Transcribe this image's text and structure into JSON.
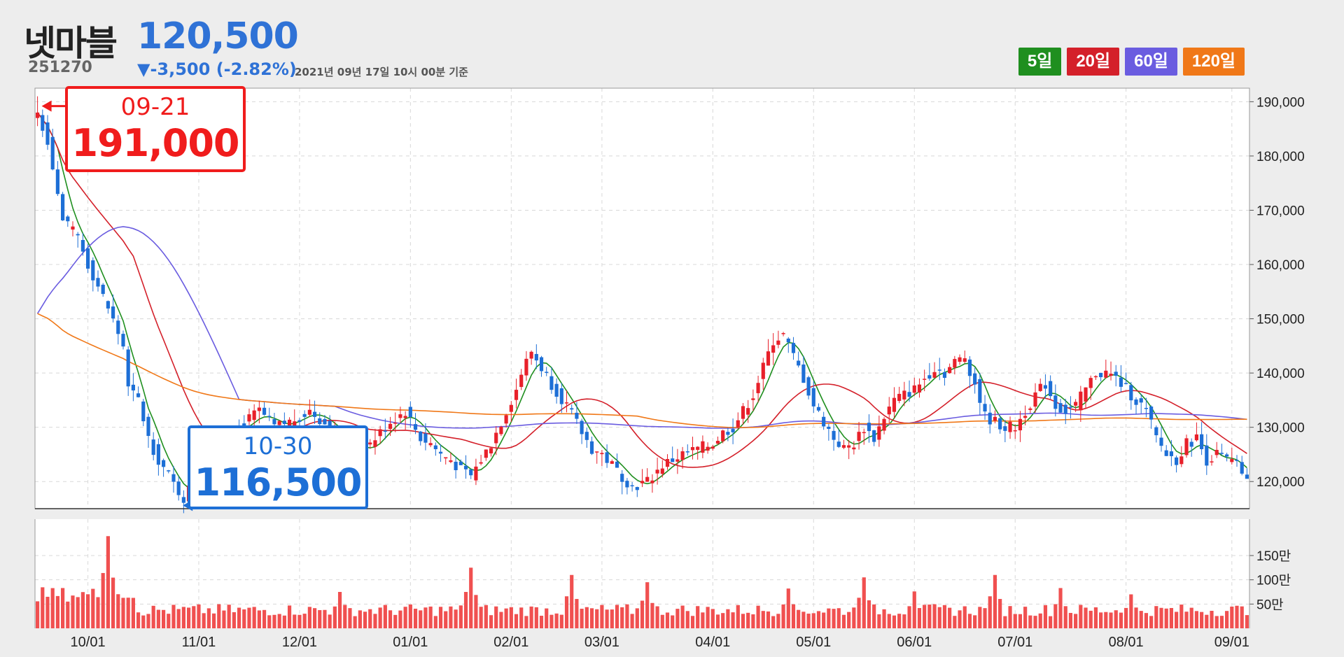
{
  "header": {
    "name": "넷마블",
    "code": "251270",
    "price": "120,500",
    "change": "▼-3,500 (-2.82%)",
    "timestamp": "2021년 09년 17일 10시 00분 기준"
  },
  "legend": [
    {
      "label": "5일",
      "color": "#1f8f1f"
    },
    {
      "label": "20일",
      "color": "#d4202a"
    },
    {
      "label": "60일",
      "color": "#6a5ce0"
    },
    {
      "label": "120일",
      "color": "#f07818"
    }
  ],
  "callouts": {
    "high": {
      "date": "09-21",
      "value": "191,000"
    },
    "low": {
      "date": "10-30",
      "value": "116,500"
    }
  },
  "colors": {
    "up": "#e8202a",
    "down": "#1d6fd6",
    "volume": "#f05050"
  },
  "chart_data": {
    "type": "line",
    "title": "",
    "price_axis": {
      "ylim": [
        115000,
        192500
      ],
      "ticks": [
        120000,
        130000,
        140000,
        150000,
        160000,
        170000,
        180000,
        190000
      ],
      "tick_labels": [
        "120,000",
        "130,000",
        "140,000",
        "150,000",
        "160,000",
        "170,000",
        "180,000",
        "190,000"
      ]
    },
    "volume_axis": {
      "ticks": [
        500000,
        1000000,
        1500000
      ],
      "tick_labels": [
        "50만",
        "100만",
        "150만"
      ]
    },
    "x_ticks": [
      "10/01",
      "11/01",
      "12/01",
      "01/01",
      "02/01",
      "03/01",
      "04/01",
      "05/01",
      "06/01",
      "07/01",
      "08/01",
      "09/01"
    ],
    "grid": true,
    "n_sessions": 241,
    "close_anchors": [
      [
        0,
        188000
      ],
      [
        2,
        183000
      ],
      [
        5,
        168000
      ],
      [
        8,
        165000
      ],
      [
        10,
        160000
      ],
      [
        14,
        152000
      ],
      [
        17,
        145000
      ],
      [
        18,
        137000
      ],
      [
        20,
        135000
      ],
      [
        22,
        128000
      ],
      [
        24,
        124000
      ],
      [
        26,
        121000
      ],
      [
        28,
        118000
      ],
      [
        29,
        117000
      ],
      [
        31,
        120000
      ],
      [
        33,
        124000
      ],
      [
        36,
        128000
      ],
      [
        40,
        130000
      ],
      [
        44,
        133000
      ],
      [
        47,
        130000
      ],
      [
        50,
        131000
      ],
      [
        54,
        133000
      ],
      [
        58,
        130000
      ],
      [
        62,
        127000
      ],
      [
        64,
        125000
      ],
      [
        66,
        127000
      ],
      [
        70,
        131000
      ],
      [
        73,
        133000
      ],
      [
        76,
        128000
      ],
      [
        78,
        127000
      ],
      [
        80,
        125000
      ],
      [
        82,
        124000
      ],
      [
        84,
        122000
      ],
      [
        86,
        121000
      ],
      [
        88,
        124000
      ],
      [
        90,
        127000
      ],
      [
        92,
        131000
      ],
      [
        95,
        137000
      ],
      [
        96,
        140000
      ],
      [
        98,
        144000
      ],
      [
        100,
        141000
      ],
      [
        102,
        138000
      ],
      [
        105,
        134000
      ],
      [
        108,
        129000
      ],
      [
        110,
        126000
      ],
      [
        112,
        125000
      ],
      [
        114,
        123000
      ],
      [
        116,
        121000
      ],
      [
        118,
        119000
      ],
      [
        121,
        120000
      ],
      [
        124,
        123000
      ],
      [
        128,
        125000
      ],
      [
        131,
        126000
      ],
      [
        134,
        127000
      ],
      [
        136,
        129000
      ],
      [
        138,
        130000
      ],
      [
        140,
        133000
      ],
      [
        142,
        136000
      ],
      [
        144,
        141000
      ],
      [
        146,
        146000
      ],
      [
        148,
        147000
      ],
      [
        150,
        143000
      ],
      [
        152,
        139000
      ],
      [
        154,
        134000
      ],
      [
        156,
        131000
      ],
      [
        158,
        128000
      ],
      [
        160,
        126000
      ],
      [
        162,
        127000
      ],
      [
        164,
        130000
      ],
      [
        166,
        128000
      ],
      [
        168,
        132000
      ],
      [
        170,
        135000
      ],
      [
        172,
        136000
      ],
      [
        174,
        137000
      ],
      [
        176,
        139000
      ],
      [
        178,
        141000
      ],
      [
        180,
        140000
      ],
      [
        182,
        142000
      ],
      [
        184,
        143000
      ],
      [
        186,
        138000
      ],
      [
        188,
        132000
      ],
      [
        190,
        131000
      ],
      [
        192,
        130000
      ],
      [
        194,
        130000
      ],
      [
        196,
        133000
      ],
      [
        198,
        136000
      ],
      [
        200,
        138000
      ],
      [
        202,
        134000
      ],
      [
        204,
        133000
      ],
      [
        206,
        134000
      ],
      [
        208,
        137000
      ],
      [
        210,
        140000
      ],
      [
        212,
        140000
      ],
      [
        214,
        139000
      ],
      [
        216,
        137000
      ],
      [
        218,
        135000
      ],
      [
        220,
        133000
      ],
      [
        222,
        128000
      ],
      [
        224,
        125000
      ],
      [
        226,
        124000
      ],
      [
        228,
        127000
      ],
      [
        230,
        128000
      ],
      [
        232,
        124000
      ],
      [
        234,
        125000
      ],
      [
        236,
        124000
      ],
      [
        238,
        123000
      ],
      [
        240,
        120500
      ]
    ],
    "volume_peak_sessions": [
      [
        14,
        1900000
      ],
      [
        86,
        1250000
      ],
      [
        60,
        750000
      ],
      [
        106,
        1100000
      ],
      [
        164,
        1050000
      ],
      [
        190,
        1100000
      ],
      [
        121,
        950000
      ],
      [
        149,
        820000
      ],
      [
        174,
        760000
      ],
      [
        203,
        830000
      ],
      [
        217,
        700000
      ]
    ],
    "series": [
      {
        "name": "5일",
        "color": "#1f8f1f",
        "period": 5
      },
      {
        "name": "20일",
        "color": "#d4202a",
        "period": 20
      },
      {
        "name": "60일",
        "color": "#6a5ce0",
        "period": 60
      },
      {
        "name": "120일",
        "color": "#f07818",
        "period": 120
      }
    ],
    "annotations": [
      {
        "label": "09-21",
        "value": 191000,
        "kind": "high"
      },
      {
        "label": "10-30",
        "value": 116500,
        "kind": "low"
      }
    ]
  }
}
